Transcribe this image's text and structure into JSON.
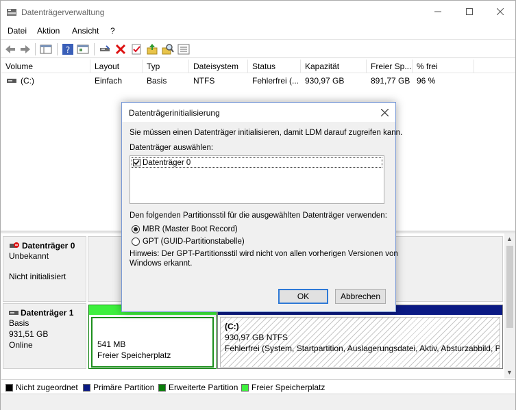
{
  "window": {
    "title": "Datenträgerverwaltung"
  },
  "menu": [
    "Datei",
    "Aktion",
    "Ansicht",
    "?"
  ],
  "columns": [
    "Volume",
    "Layout",
    "Typ",
    "Dateisystem",
    "Status",
    "Kapazität",
    "Freier Sp...",
    "% frei"
  ],
  "volumes": [
    {
      "volume": "(C:)",
      "layout": "Einfach",
      "typ": "Basis",
      "dateisystem": "NTFS",
      "status": "Fehlerfrei (...",
      "kapazitaet": "930,97 GB",
      "frei": "891,77 GB",
      "prozent": "96 %"
    }
  ],
  "disks": [
    {
      "name": "Datenträger 0",
      "line1": "Unbekannt",
      "line2": "Nicht initialisiert"
    },
    {
      "name": "Datenträger 1",
      "line1": "Basis",
      "line2": "931,51 GB",
      "line3": "Online",
      "free_size": "541 MB",
      "free_label": "Freier Speicherplatz",
      "c_name": "(C:)",
      "c_size": "930,97 GB NTFS",
      "c_status": "Fehlerfrei (System, Startpartition, Auslagerungsdatei, Aktiv, Absturzabbild, Pr"
    }
  ],
  "legend": [
    {
      "label": "Nicht zugeordnet",
      "color": "#000000"
    },
    {
      "label": "Primäre Partition",
      "color": "#0b1a84"
    },
    {
      "label": "Erweiterte Partition",
      "color": "#0a7d0a"
    },
    {
      "label": "Freier Speicherplatz",
      "color": "#3df03d"
    }
  ],
  "dialog": {
    "title": "Datenträgerinitialisierung",
    "intro": "Sie müssen einen Datenträger initialisieren, damit LDM darauf zugreifen kann.",
    "select_label": "Datenträger auswählen:",
    "disk_item": "Datenträger 0",
    "disk_checked": true,
    "style_label": "Den folgenden Partitionsstil für die ausgewählten Datenträger verwenden:",
    "mbr": "MBR (Master Boot Record)",
    "gpt": "GPT (GUID-Partitionstabelle)",
    "selected_style": "MBR",
    "hint_line1": "Hinweis: Der GPT-Partitionsstil wird nicht von allen vorherigen Versionen von",
    "hint_line2": "Windows erkannt.",
    "ok": "OK",
    "cancel": "Abbrechen"
  }
}
